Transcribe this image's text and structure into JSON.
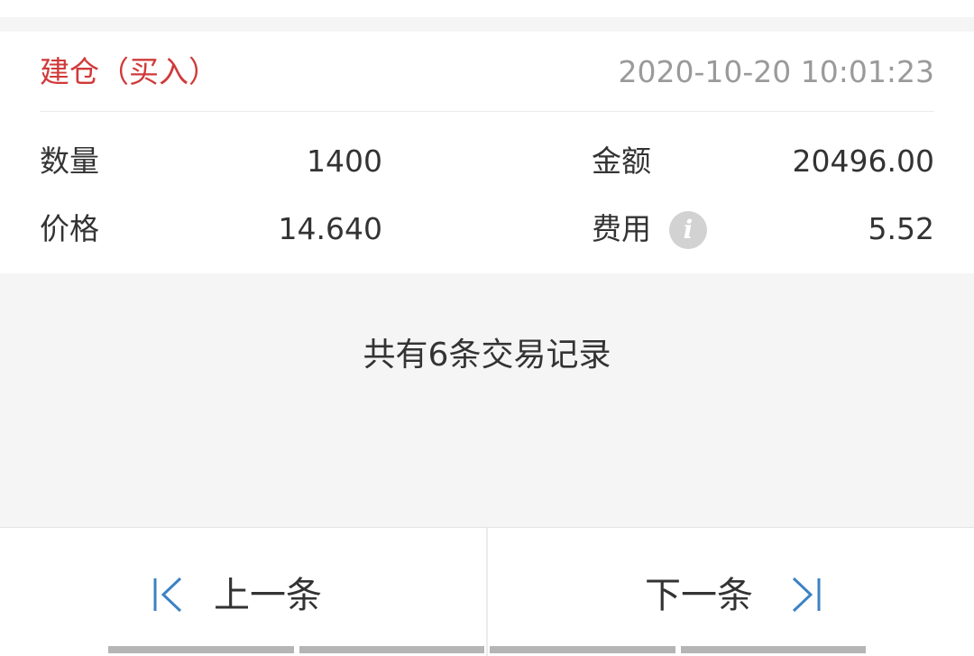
{
  "trade": {
    "type_label": "建仓（买入）",
    "timestamp": "2020-10-20 10:01:23",
    "fields": {
      "quantity_label": "数量",
      "quantity_value": "1400",
      "amount_label": "金额",
      "amount_value": "20496.00",
      "price_label": "价格",
      "price_value": "14.640",
      "fee_label": "费用",
      "fee_value": "5.52",
      "fee_info_icon": "i"
    }
  },
  "summary_text": "共有6条交易记录",
  "navigation": {
    "prev_label": "上一条",
    "next_label": "下一条",
    "prev_icon": "skip-first-icon",
    "next_icon": "skip-last-icon"
  },
  "colors": {
    "trade_type": "#d03a3a",
    "nav_icon": "#3b82c4",
    "timestamp": "#9a9a9a"
  }
}
